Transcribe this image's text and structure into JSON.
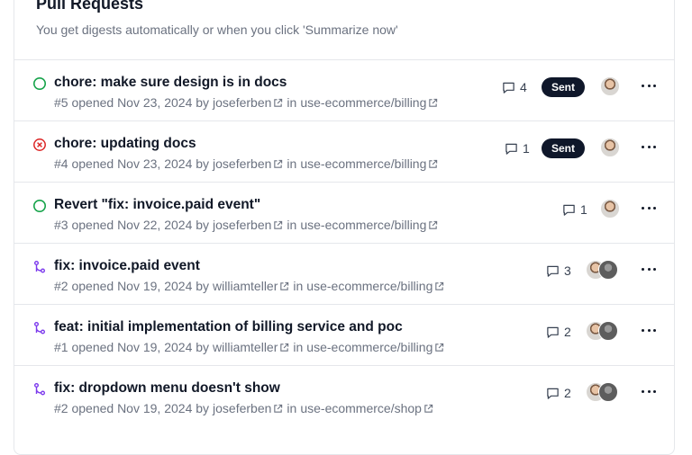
{
  "header": {
    "title": "Pull Requests",
    "subtitle": "You get digests automatically or when you click 'Summarize now'"
  },
  "colors": {
    "open": "#16a34a",
    "closed": "#dc2626",
    "merged": "#7c3aed",
    "badge": "#0f172a"
  },
  "pull_requests": [
    {
      "status": "open",
      "title": "chore: make sure design is in docs",
      "number_opened": "#5 opened Nov 23, 2024 by",
      "author": "joseferben",
      "in": "in",
      "repo": "use-ecommerce/billing",
      "comments": "4",
      "badge": "Sent",
      "avatar_count": 1
    },
    {
      "status": "closed",
      "title": "chore: updating docs",
      "number_opened": "#4 opened Nov 23, 2024 by",
      "author": "joseferben",
      "in": "in",
      "repo": "use-ecommerce/billing",
      "comments": "1",
      "badge": "Sent",
      "avatar_count": 1
    },
    {
      "status": "open",
      "title": "Revert \"fix: invoice.paid event\"",
      "number_opened": "#3 opened Nov 22, 2024 by",
      "author": "joseferben",
      "in": "in",
      "repo": "use-ecommerce/billing",
      "comments": "1",
      "badge": "",
      "avatar_count": 1
    },
    {
      "status": "merged",
      "title": "fix: invoice.paid event",
      "number_opened": "#2 opened Nov 19, 2024 by",
      "author": "williamteller",
      "in": "in",
      "repo": "use-ecommerce/billing",
      "comments": "3",
      "badge": "",
      "avatar_count": 2
    },
    {
      "status": "merged",
      "title": "feat: initial implementation of billing service and poc",
      "number_opened": "#1 opened Nov 19, 2024 by",
      "author": "williamteller",
      "in": "in",
      "repo": "use-ecommerce/billing",
      "comments": "2",
      "badge": "",
      "avatar_count": 2
    },
    {
      "status": "merged",
      "title": "fix: dropdown menu doesn't show",
      "number_opened": "#2 opened Nov 19, 2024 by",
      "author": "joseferben",
      "in": "in",
      "repo": "use-ecommerce/shop",
      "comments": "2",
      "badge": "",
      "avatar_count": 2
    }
  ]
}
